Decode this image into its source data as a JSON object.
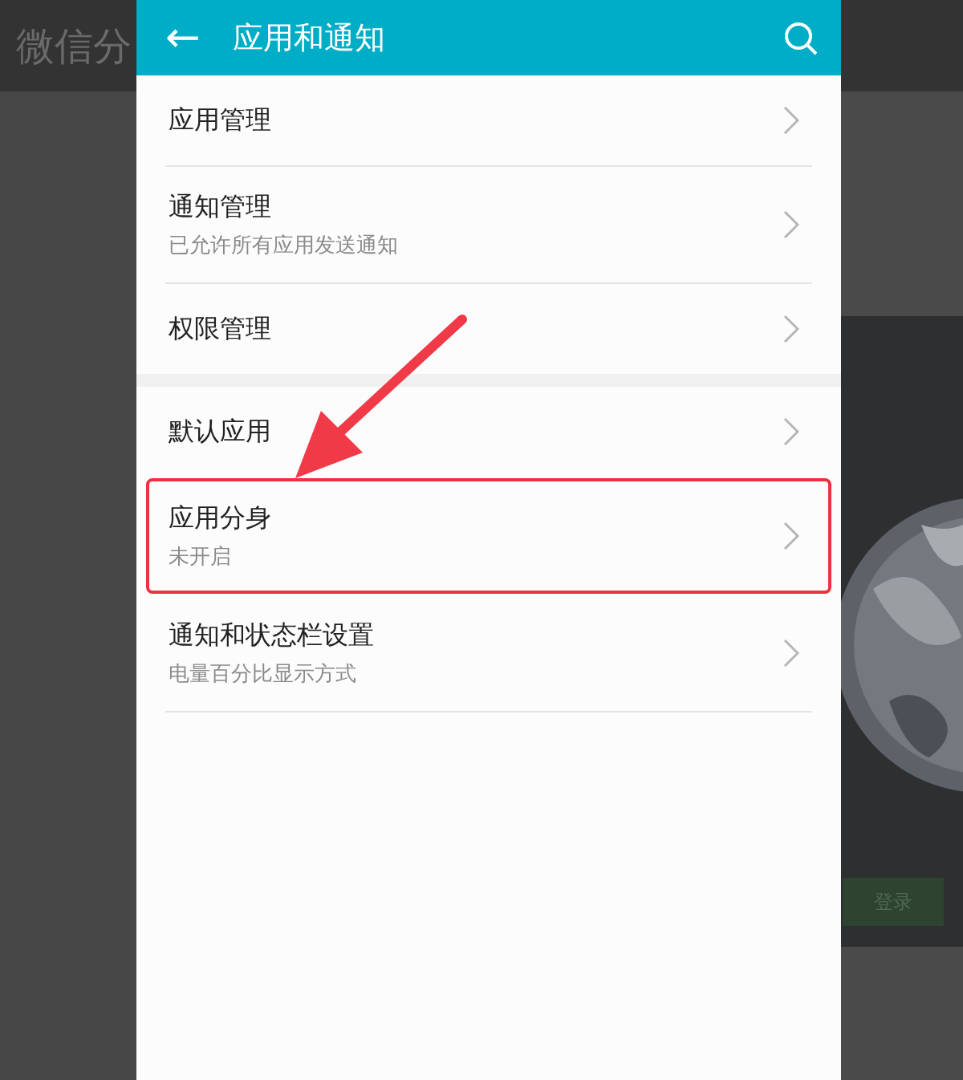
{
  "background": {
    "heading": "微信分",
    "button": "登录"
  },
  "header": {
    "back_icon": "←",
    "title": "应用和通知"
  },
  "sections": [
    {
      "items": [
        {
          "title": "应用管理",
          "highlighted": false
        },
        {
          "title": "通知管理",
          "subtitle": "已允许所有应用发送通知",
          "highlighted": false
        },
        {
          "title": "权限管理",
          "highlighted": false
        }
      ]
    },
    {
      "items": [
        {
          "title": "默认应用",
          "highlighted": false
        },
        {
          "title": "应用分身",
          "subtitle": "未开启",
          "highlighted": true
        },
        {
          "title": "通知和状态栏设置",
          "subtitle": "电量百分比显示方式",
          "highlighted": false
        }
      ]
    }
  ]
}
